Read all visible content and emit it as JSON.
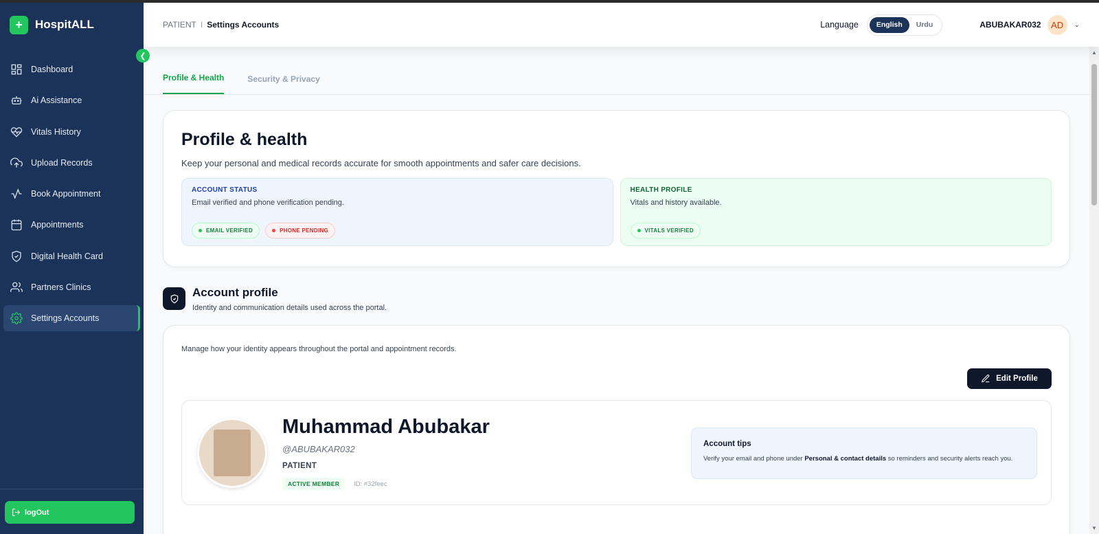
{
  "brand": {
    "logo_glyph": "+",
    "name": "HospitALL"
  },
  "sidebar": {
    "items": [
      {
        "label": "Dashboard",
        "icon": "grid-icon"
      },
      {
        "label": "Ai Assistance",
        "icon": "robot-icon"
      },
      {
        "label": "Vitals History",
        "icon": "heart-pulse-icon"
      },
      {
        "label": "Upload Records",
        "icon": "cloud-upload-icon"
      },
      {
        "label": "Book Appointment",
        "icon": "activity-icon"
      },
      {
        "label": "Appointments",
        "icon": "calendar-icon"
      },
      {
        "label": "Digital Health Card",
        "icon": "shield-check-icon"
      },
      {
        "label": "Partners Clinics",
        "icon": "users-icon"
      },
      {
        "label": "Settings Accounts",
        "icon": "gear-icon",
        "active": true
      }
    ],
    "logout_label": "logOut"
  },
  "topbar": {
    "breadcrumb_root": "PATIENT",
    "breadcrumb_separator": "I",
    "breadcrumb_current": "Settings Accounts",
    "language_label": "Language",
    "languages": [
      "English",
      "Urdu"
    ],
    "selected_language": "English",
    "username": "ABUBAKAR032",
    "avatar_initials": "AD"
  },
  "tabs": [
    {
      "label": "Profile & Health",
      "active": true
    },
    {
      "label": "Security & Privacy",
      "active": false
    }
  ],
  "profile_health": {
    "title": "Profile & health",
    "subtitle": "Keep your personal and medical records accurate for smooth appointments and safer care decisions.",
    "account_status": {
      "title": "ACCOUNT STATUS",
      "text": "Email verified and phone verification pending.",
      "badges": [
        {
          "label": "EMAIL VERIFIED",
          "status": "ok"
        },
        {
          "label": "PHONE PENDING",
          "status": "warn"
        }
      ]
    },
    "health_profile": {
      "title": "HEALTH PROFILE",
      "text": "Vitals and history available.",
      "badges": [
        {
          "label": "VITALS VERIFIED",
          "status": "ok"
        }
      ]
    }
  },
  "account_profile": {
    "title": "Account profile",
    "subtitle": "Identity and communication details used across the portal.",
    "description": "Manage how your identity appears throughout the portal and appointment records.",
    "edit_button": "Edit Profile",
    "name": "Muhammad Abubakar",
    "handle": "@ABUBAKAR032",
    "role": "PATIENT",
    "member_badge": "ACTIVE MEMBER",
    "id_text": "ID: #32feec",
    "tips": {
      "title": "Account tips",
      "text_before": "Verify your email and phone under ",
      "text_bold": "Personal & contact details",
      "text_after": " so reminders and security alerts reach you."
    }
  },
  "colors": {
    "sidebar_bg": "#1b3358",
    "accent_green": "#22c55e",
    "dark": "#0f172a"
  }
}
